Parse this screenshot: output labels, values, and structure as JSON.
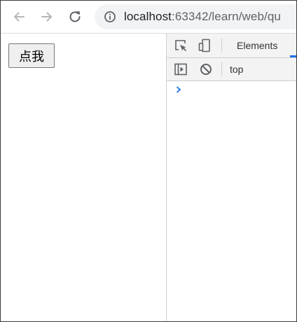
{
  "browser": {
    "url_host": "localhost",
    "url_rest": ":63342/learn/web/qu",
    "icons": {
      "back": "arrow-left-icon",
      "forward": "arrow-right-icon",
      "reload": "reload-icon",
      "site_info": "info-circle-icon"
    }
  },
  "page": {
    "button_label": "点我"
  },
  "devtools": {
    "tabs": [
      "Elements"
    ],
    "console_context": "top",
    "accent_color": "#1a73e8",
    "icons": {
      "inspect": "inspect-element-icon",
      "device": "device-toolbar-icon",
      "sidebar": "console-sidebar-icon",
      "clear": "clear-console-icon",
      "prompt": "console-prompt-chevron-icon"
    }
  }
}
